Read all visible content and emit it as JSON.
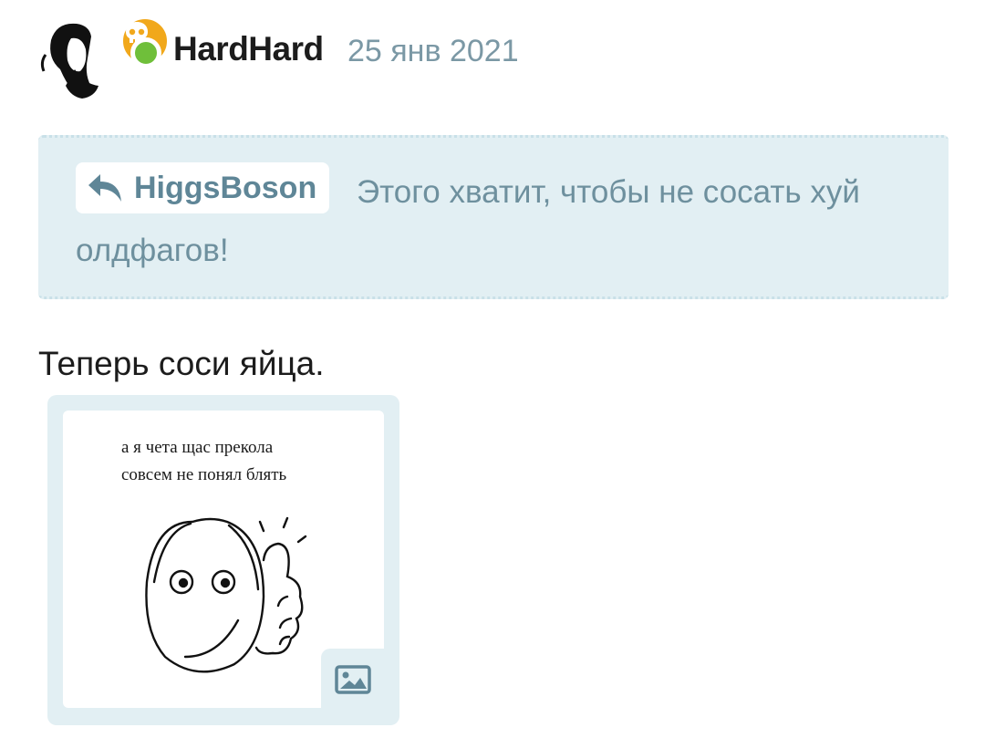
{
  "post": {
    "author": "HardHard",
    "date": "25 янв 2021",
    "avatar_icon": "portrait-avatar",
    "badge_icon": "skull-icon",
    "status": "online",
    "colors": {
      "badge": "#f1a81b",
      "online": "#6fbf3a",
      "quote_bg": "#e2eff3",
      "muted_text": "#7b98a5"
    }
  },
  "quote": {
    "reply_icon": "reply-arrow-icon",
    "author": "HiggsBoson",
    "text": "Этого хватит, чтобы не сосать хуй олдфагов!"
  },
  "body": {
    "text": "Теперь соси яйца."
  },
  "attachment": {
    "caption_line1": "а я чета щас прекола",
    "caption_line2": "совсем не понял блять",
    "type_icon": "image-icon"
  }
}
